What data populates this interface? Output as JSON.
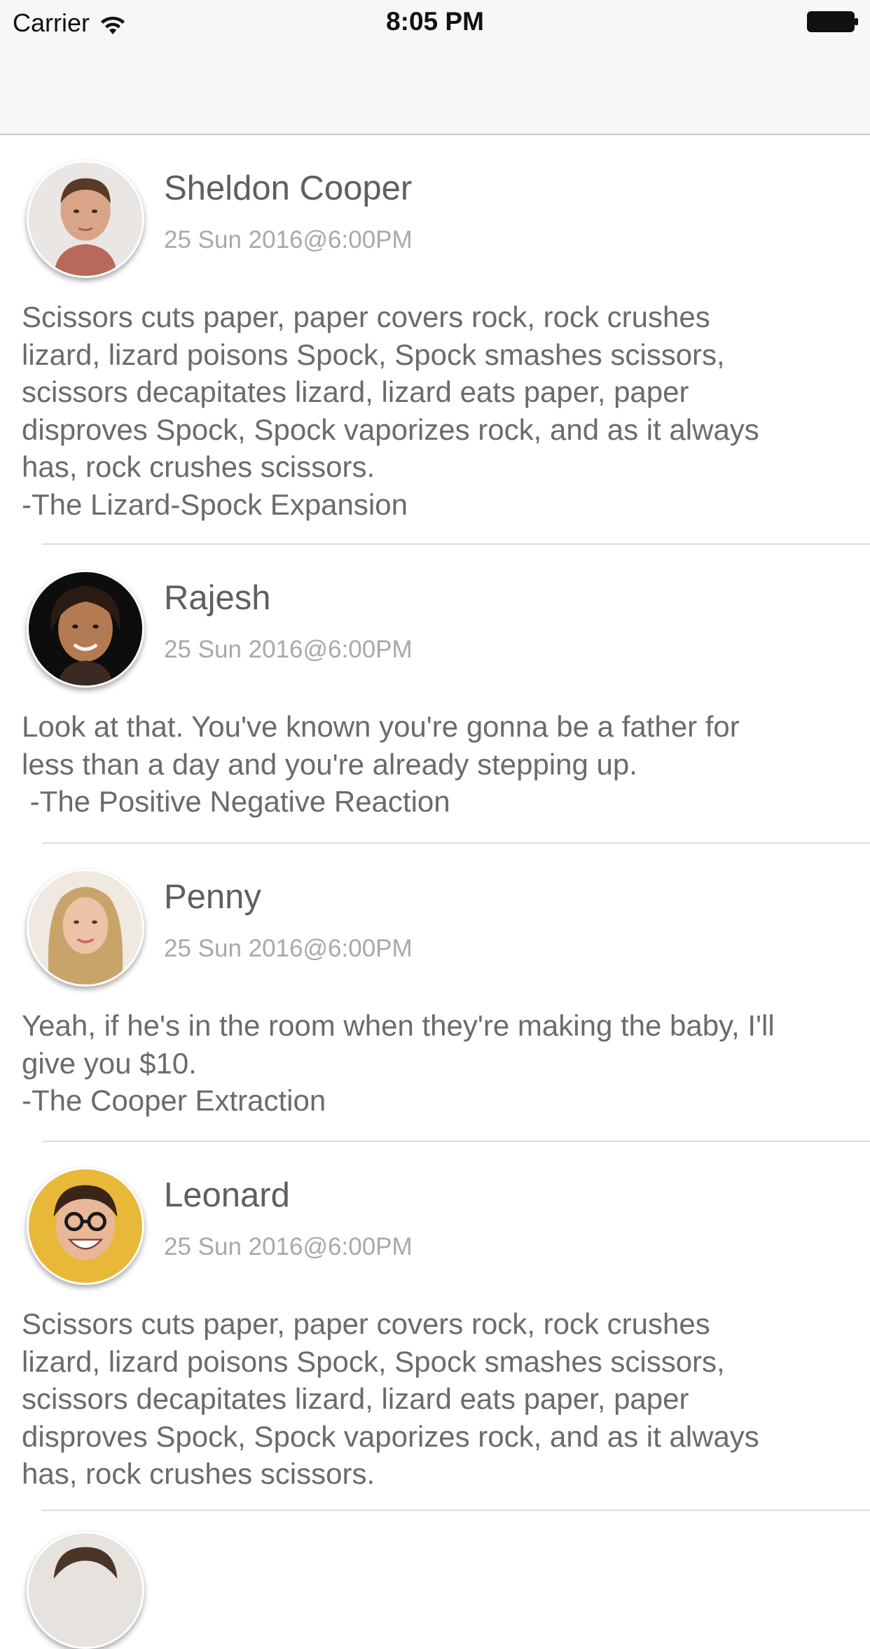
{
  "status_bar": {
    "carrier": "Carrier",
    "time": "8:05 PM"
  },
  "feed": {
    "posts": [
      {
        "name": "Sheldon Cooper",
        "date": "25 Sun 2016@6:00PM",
        "quote": "Scissors cuts paper, paper covers rock, rock crushes\nlizard, lizard poisons Spock, Spock smashes scissors,\nscissors decapitates lizard, lizard eats paper, paper\ndisproves Spock, Spock vaporizes rock, and as it always\nhas, rock crushes scissors.\n-The Lizard-Spock Expansion",
        "avatar_icon": "person-avatar-icon"
      },
      {
        "name": "Rajesh",
        "date": "25 Sun 2016@6:00PM",
        "quote": "Look at that. You've known you're gonna be a father for\nless than a day and you're already stepping up.\n -The Positive Negative Reaction",
        "avatar_icon": "person-avatar-icon"
      },
      {
        "name": "Penny",
        "date": "25 Sun 2016@6:00PM",
        "quote": "Yeah, if he's in the room when they're making the baby, I'll\ngive you $10.\n-The Cooper Extraction",
        "avatar_icon": "person-avatar-icon"
      },
      {
        "name": "Leonard",
        "date": "25 Sun 2016@6:00PM",
        "quote": "Scissors cuts paper, paper covers rock, rock crushes\nlizard, lizard poisons Spock, Spock smashes scissors,\nscissors decapitates lizard, lizard eats paper, paper\ndisproves Spock, Spock vaporizes rock, and as it always\nhas, rock crushes scissors.",
        "avatar_icon": "person-avatar-icon"
      }
    ]
  },
  "colors": {
    "nav_background": "#f7f7f7",
    "name_text": "#5e5e63",
    "date_text": "#a8a8ad",
    "body_text": "#6a6a6f",
    "separator": "#dcdce0"
  }
}
